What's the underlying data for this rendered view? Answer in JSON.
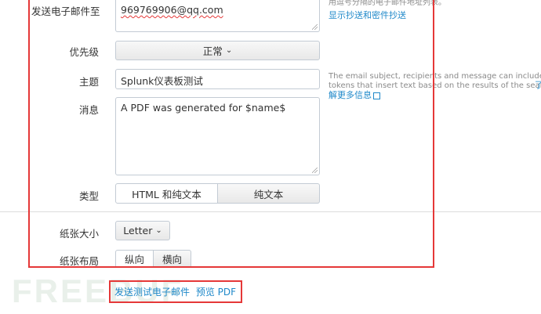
{
  "form": {
    "email_to": {
      "label": "发送电子邮件至",
      "value": "969769906@qq.com"
    },
    "email_help": {
      "text": "用逗号分隔的电子邮件地址列表。",
      "link": "显示抄送和密件抄送"
    },
    "priority": {
      "label": "优先级",
      "value": "正常"
    },
    "subject": {
      "label": "主题",
      "value": "Splunk仪表板测试"
    },
    "subject_help": {
      "line1": "The email subject, recipients and message can include",
      "line2": "tokens that insert text based on the results of the search.",
      "link": "解更多信息",
      "prefix_char": "了"
    },
    "message": {
      "label": "消息",
      "value": "A PDF was generated for $name$"
    },
    "type": {
      "label": "类型",
      "options": [
        "HTML 和纯文本",
        "纯文本"
      ],
      "selected": "HTML 和纯文本"
    },
    "paper_size": {
      "label": "纸张大小",
      "value": "Letter"
    },
    "paper_layout": {
      "label": "纸张布局",
      "options": [
        "纵向",
        "横向"
      ],
      "selected": "纵向"
    }
  },
  "actions": {
    "send_test": "发送测试电子邮件",
    "preview_pdf": "预览 PDF"
  },
  "watermark": "FREEBUF",
  "colors": {
    "link": "#1e88c9",
    "highlight_box": "#e53838",
    "border": "#c3cbd4"
  }
}
